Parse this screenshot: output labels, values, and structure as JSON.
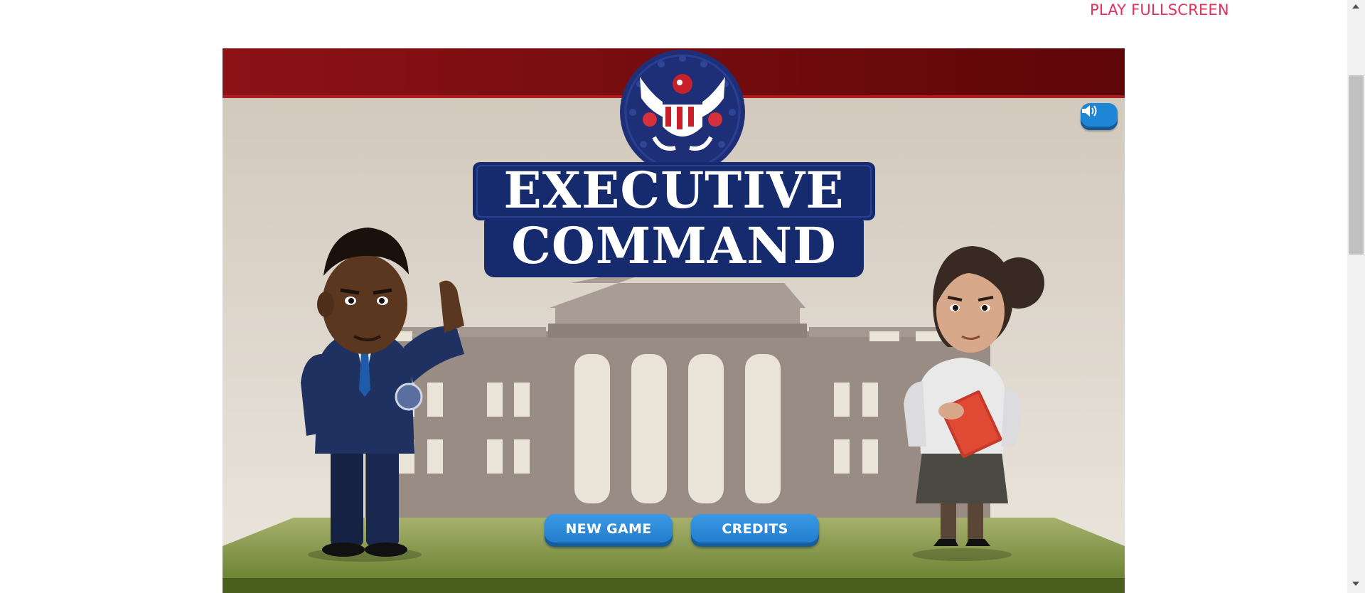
{
  "header": {
    "fullscreen_label": "PLAY FULLSCREEN"
  },
  "game": {
    "title_line1": "EXECUTIVE",
    "title_line2": "COMMAND",
    "buttons": {
      "new_game": "NEW GAME",
      "credits": "CREDITS"
    },
    "sound_icon": "speaker-volume-icon"
  },
  "colors": {
    "link": "#e8315a",
    "banner_red": "#8a1014",
    "title_navy": "#162a6e",
    "button_blue": "#2a86d6",
    "grass": "#7e9b3d"
  }
}
